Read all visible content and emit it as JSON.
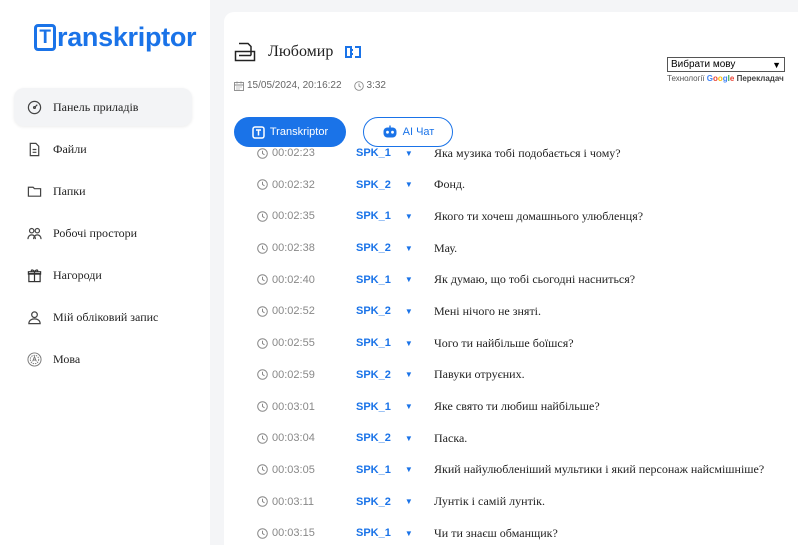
{
  "sidebar": {
    "logo_letter": "T",
    "logo_rest": "ranskriptor",
    "items": [
      {
        "label": "Панель приладів",
        "icon": "dashboard-gauge-icon"
      },
      {
        "label": "Файли",
        "icon": "file-icon"
      },
      {
        "label": "Папки",
        "icon": "folder-icon"
      },
      {
        "label": "Робочі простори",
        "icon": "workspace-users-icon"
      },
      {
        "label": "Нагороди",
        "icon": "gift-icon"
      },
      {
        "label": "Мій обліковий запис",
        "icon": "user-icon"
      },
      {
        "label": "Мова",
        "icon": "language-icon"
      }
    ]
  },
  "header": {
    "title": "Любомир",
    "date": "15/05/2024, 20:16:22",
    "duration": "3:32"
  },
  "language": {
    "select_label": "Вибрати мову",
    "powered_prefix": "Технології",
    "powered_google": "Google",
    "powered_suffix": "Перекладач"
  },
  "tabs": {
    "transkriptor": "Transkriptor",
    "ai_chat": "AI Чат"
  },
  "transcript": [
    {
      "time": "00:02:23",
      "speaker": "SPK_1",
      "text": "Яка музика тобі подобається і чому?"
    },
    {
      "time": "00:02:32",
      "speaker": "SPK_2",
      "text": "Фонд."
    },
    {
      "time": "00:02:35",
      "speaker": "SPK_1",
      "text": "Якого ти хочеш домашнього улюбленця?"
    },
    {
      "time": "00:02:38",
      "speaker": "SPK_2",
      "text": "Мау."
    },
    {
      "time": "00:02:40",
      "speaker": "SPK_1",
      "text": "Як думаю, що тобі сьогодні насниться?"
    },
    {
      "time": "00:02:52",
      "speaker": "SPK_2",
      "text": "Мені нічого не зняті."
    },
    {
      "time": "00:02:55",
      "speaker": "SPK_1",
      "text": "Чого ти найбільше боїшся?"
    },
    {
      "time": "00:02:59",
      "speaker": "SPK_2",
      "text": "Павуки отруєних."
    },
    {
      "time": "00:03:01",
      "speaker": "SPK_1",
      "text": "Яке свято ти любиш найбільше?"
    },
    {
      "time": "00:03:04",
      "speaker": "SPK_2",
      "text": "Паска."
    },
    {
      "time": "00:03:05",
      "speaker": "SPK_1",
      "text": "Який найулюбленіший мультики і який персонаж найсмішніше?"
    },
    {
      "time": "00:03:11",
      "speaker": "SPK_2",
      "text": "Лунтік і самій лунтік."
    },
    {
      "time": "00:03:15",
      "speaker": "SPK_1",
      "text": "Чи ти знаєш обманщик?"
    }
  ],
  "colors": {
    "accent": "#1a73e8"
  }
}
